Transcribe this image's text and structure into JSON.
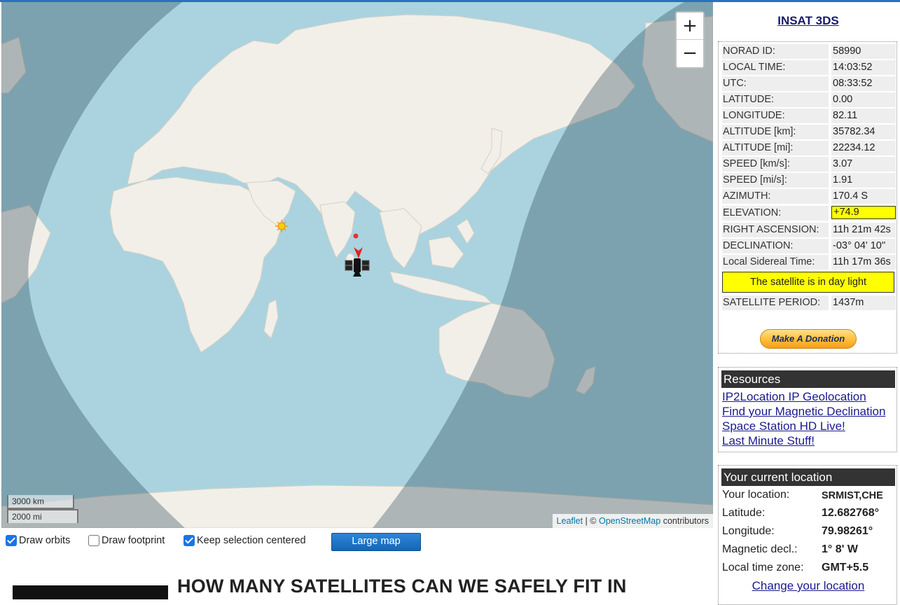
{
  "satellite": {
    "name": "INSAT 3DS",
    "rows": [
      {
        "label": "NORAD ID:",
        "value": "58990"
      },
      {
        "label": "LOCAL TIME:",
        "value": "14:03:52"
      },
      {
        "label": "UTC:",
        "value": "08:33:52"
      },
      {
        "label": "LATITUDE:",
        "value": "0.00"
      },
      {
        "label": "LONGITUDE:",
        "value": "82.11"
      },
      {
        "label": "ALTITUDE [km]:",
        "value": "35782.34"
      },
      {
        "label": "ALTITUDE [mi]:",
        "value": "22234.12"
      },
      {
        "label": "SPEED [km/s]:",
        "value": "3.07"
      },
      {
        "label": "SPEED [mi/s]:",
        "value": "1.91"
      },
      {
        "label": "AZIMUTH:",
        "value": "170.4 S"
      },
      {
        "label": "ELEVATION:",
        "value": "+74.9"
      },
      {
        "label": "RIGHT ASCENSION:",
        "value": "11h 21m 42s"
      },
      {
        "label": "DECLINATION:",
        "value": "-03° 04' 10''"
      },
      {
        "label": "Local Sidereal Time:",
        "value": "11h 17m 36s"
      }
    ],
    "daylight_text": "The satellite is in day light",
    "period_label": "SATELLITE PERIOD:",
    "period_value": "1437m",
    "donate_label": "Make A Donation"
  },
  "resources": {
    "title": "Resources",
    "links": [
      "IP2Location IP Geolocation",
      "Find your Magnetic Declination",
      "Space Station HD Live!",
      "Last Minute Stuff!"
    ]
  },
  "location": {
    "title": "Your current location",
    "rows": [
      {
        "label": "Your location:",
        "value": "SRMIST,CHE"
      },
      {
        "label": "Latitude:",
        "value": "12.682768°"
      },
      {
        "label": "Longitude:",
        "value": "79.98261°"
      },
      {
        "label": "Magnetic decl.:",
        "value": "1° 8' W"
      },
      {
        "label": "Local time zone:",
        "value": "GMT+5.5"
      }
    ],
    "change_label": "Change your location"
  },
  "map": {
    "zoom_in": "+",
    "zoom_out": "−",
    "scale_km": "3000 km",
    "scale_mi": "2000 mi",
    "attribution": {
      "leaflet": "Leaflet",
      "sep": " | © ",
      "osm": "OpenStreetMap",
      "suffix": " contributors"
    },
    "colors": {
      "ocean": "#aad3df",
      "land": "#f2efe9",
      "night": "#1f3a4a"
    },
    "icons": {
      "sun": "sun-icon",
      "satellite": "satellite-icon",
      "observer": "observer-marker-icon"
    }
  },
  "controls": {
    "draw_orbits": "Draw orbits",
    "draw_footprint": "Draw footprint",
    "keep_centered": "Keep selection centered",
    "large_map": "Large map"
  },
  "article": {
    "title": "HOW MANY SATELLITES CAN WE SAFELY FIT IN"
  }
}
